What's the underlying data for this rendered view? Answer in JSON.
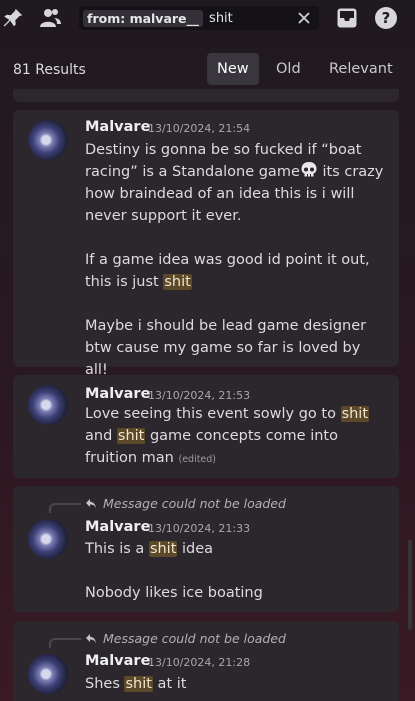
{
  "toolbar": {
    "icons": [
      "pin-icon",
      "members-icon",
      "inbox-icon",
      "help-icon"
    ],
    "search": {
      "filter_label": "from: malvare__",
      "query": "shit"
    }
  },
  "results": {
    "count_label": "81 Results",
    "sort_tabs": [
      {
        "label": "New",
        "active": true
      },
      {
        "label": "Old",
        "active": false
      },
      {
        "label": "Relevant",
        "active": false
      }
    ]
  },
  "messages": [
    {
      "author": "Malvare",
      "timestamp": "13/10/2024, 21:54",
      "paragraphs": [
        [
          "Destiny is gonna be so fucked if “boat racing” is a Standalone game",
          "💀",
          " its crazy how braindead of an idea this is i will never support it ever."
        ],
        [
          "If a game idea was good id point it out, this is just ",
          "shit"
        ],
        [
          "Maybe i should be lead game designer btw cause my game so far is loved by all!"
        ]
      ]
    },
    {
      "author": "Malvare",
      "timestamp": "13/10/2024, 21:53",
      "paragraphs": [
        [
          "Love seeing this event sowly go to ",
          "shit",
          " and ",
          "shit",
          " game concepts come into fruition man"
        ]
      ],
      "edited": "(edited)"
    },
    {
      "reply": "Message could not be loaded",
      "author": "Malvare",
      "timestamp": "13/10/2024, 21:33",
      "paragraphs": [
        [
          "This is a ",
          "shit",
          " idea"
        ],
        [
          "Nobody likes ice boating"
        ]
      ]
    },
    {
      "reply": "Message could not be loaded",
      "author": "Malvare",
      "timestamp": "13/10/2024, 21:28",
      "paragraphs": [
        [
          "Shes ",
          "shit",
          " at it"
        ]
      ]
    }
  ],
  "colors": {
    "highlight": "#5b4929",
    "card": "#2b272d",
    "active_tab": "#3a363e"
  }
}
